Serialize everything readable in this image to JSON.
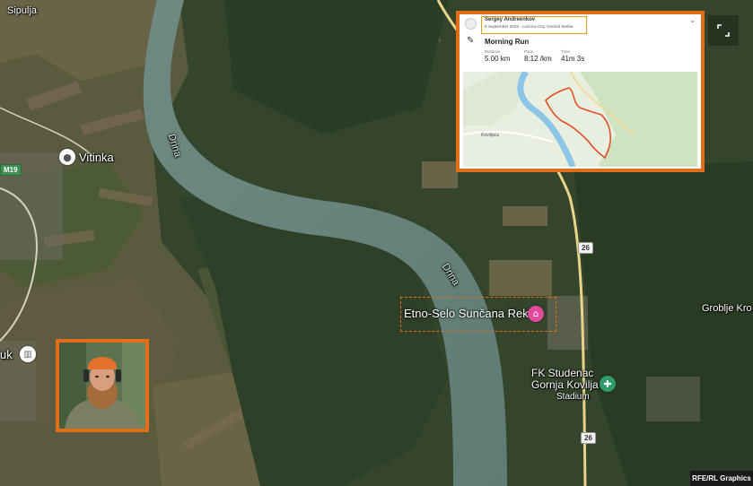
{
  "places": {
    "sipulja": "Sipulja",
    "vitinka": "Vitinka",
    "uk": "uk",
    "groblje": "Groblje Kro",
    "fk_line1": "FK Studenac",
    "fk_line2": "Gornja Kovilja",
    "fk_line3": "Stadium"
  },
  "river": {
    "label_upper": "Drina",
    "label_lower": "Drina"
  },
  "roads": {
    "m19": "M19",
    "r26_upper": "26",
    "r26_lower": "26"
  },
  "highlight": {
    "label": "Etno-Selo Sunčana Reka",
    "accent_color": "#e36e19"
  },
  "strava": {
    "athlete_name": "Sergey Andreenkov",
    "athlete_meta": "8 September 2023 · Loznica City, Central Serbia",
    "activity_title": "Morning Run",
    "distance_label": "Distance",
    "distance_value": "5.00 km",
    "pace_label": "Pace",
    "pace_value": "8:12 /km",
    "time_label": "Time",
    "time_value": "41m 3s",
    "mini_map_place": "Koviljaca",
    "route_color": "#e0502a"
  },
  "icons": {
    "shoe": "shoe-icon",
    "expand": "expand-icon",
    "chevron": "chevron-down-icon",
    "pin": "location-pin-icon",
    "lodging": "lodging-icon",
    "stadium": "stadium-icon",
    "museum": "museum-icon"
  },
  "credit": "RFE/RL Graphics"
}
